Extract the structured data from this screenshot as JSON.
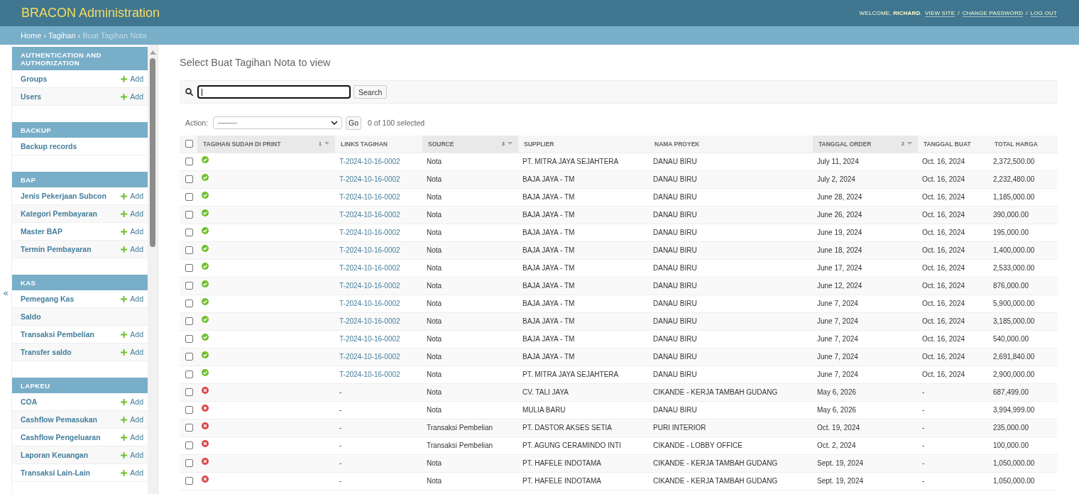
{
  "header": {
    "title": "BRACON Administration",
    "user_tools": [
      {
        "kind": "greeting",
        "text": "WELCOME, **RICHARD**."
      },
      {
        "kind": "link",
        "text": "VIEW SITE"
      },
      {
        "kind": "separator",
        "text": "/"
      },
      {
        "kind": "link",
        "text": "CHANGE PASSWORD"
      },
      {
        "kind": "separator",
        "text": "/"
      },
      {
        "kind": "link",
        "text": "LOG OUT"
      }
    ]
  },
  "breadcrumbs": [
    {
      "kind": "link",
      "text": "Home"
    },
    {
      "kind": "separator",
      "text": "›"
    },
    {
      "kind": "link",
      "text": "Tagihan"
    },
    {
      "kind": "separator",
      "text": "›"
    },
    {
      "kind": "current",
      "text": "Buat Tagihan Nota"
    }
  ],
  "sidebar": {
    "toggle": "«",
    "modules": [
      {
        "caption": "AUTHENTICATION AND AUTHORIZATION",
        "models": [
          {
            "name": "Groups",
            "add": "Add"
          },
          {
            "name": "Users",
            "add": "Add"
          }
        ]
      },
      {
        "caption": "BACKUP",
        "models": [
          {
            "name": "Backup records"
          }
        ]
      },
      {
        "caption": "BAP",
        "models": [
          {
            "name": "Jenis Pekerjaan Subcon",
            "add": "Add"
          },
          {
            "name": "Kategori Pembayaran",
            "add": "Add"
          },
          {
            "name": "Master BAP",
            "add": "Add"
          },
          {
            "name": "Termin Pembayaran",
            "add": "Add"
          }
        ]
      },
      {
        "caption": "KAS",
        "models": [
          {
            "name": "Pemegang Kas",
            "add": "Add"
          },
          {
            "name": "Saldo"
          },
          {
            "name": "Transaksi Pembelian",
            "add": "Add"
          },
          {
            "name": "Transfer saldo",
            "add": "Add"
          }
        ]
      },
      {
        "caption": "LAPKEU",
        "models": [
          {
            "name": "COA",
            "add": "Add"
          },
          {
            "name": "Cashflow Pemasukan",
            "add": "Add"
          },
          {
            "name": "Cashflow Pengeluaran",
            "add": "Add"
          },
          {
            "name": "Laporan Keuangan",
            "add": "Add"
          },
          {
            "name": "Transaksi Lain-Lain",
            "add": "Add"
          }
        ]
      }
    ]
  },
  "main": {
    "title": "Select Buat Tagihan Nota to view",
    "search": {
      "button": "Search"
    },
    "actions": {
      "label": "Action:",
      "value": "---------",
      "button": "Go",
      "counter": "0 of 100 selected"
    }
  },
  "table": {
    "select_all": {
      "checked": false
    },
    "columns": [
      {
        "label": "TAGIHAN SUDAH DI PRINT",
        "sorted": true,
        "priority": "1"
      },
      {
        "label": "LINKS TAGIHAN",
        "sorted": false
      },
      {
        "label": "SOURCE",
        "sorted": true,
        "priority": "3"
      },
      {
        "label": "SUPPLIER",
        "sorted": false
      },
      {
        "label": "NAMA PROYEK",
        "sorted": false
      },
      {
        "label": "TANGGAL ORDER",
        "sorted": true,
        "priority": "2"
      },
      {
        "label": "TANGGAL BUAT",
        "sorted": false
      },
      {
        "label": "TOTAL HARGA",
        "sorted": false
      }
    ],
    "rows": [
      {
        "selected": false,
        "printed": true,
        "links_tagihan": {
          "kind": "link",
          "text": "T-2024-10-16-0002"
        },
        "source": "Nota",
        "supplier": "PT. MITRA JAYA SEJAHTERA",
        "nama_proyek": "DANAU BIRU",
        "tanggal_order": "July 11, 2024",
        "tanggal_buat": "Oct. 16, 2024",
        "total_harga": "2,372,500.00"
      },
      {
        "selected": false,
        "printed": true,
        "links_tagihan": {
          "kind": "link",
          "text": "T-2024-10-16-0002"
        },
        "source": "Nota",
        "supplier": "BAJA JAYA - TM",
        "nama_proyek": "DANAU BIRU",
        "tanggal_order": "July 2, 2024",
        "tanggal_buat": "Oct. 16, 2024",
        "total_harga": "2,232,480.00"
      },
      {
        "selected": false,
        "printed": true,
        "links_tagihan": {
          "kind": "link",
          "text": "T-2024-10-16-0002"
        },
        "source": "Nota",
        "supplier": "BAJA JAYA - TM",
        "nama_proyek": "DANAU BIRU",
        "tanggal_order": "June 28, 2024",
        "tanggal_buat": "Oct. 16, 2024",
        "total_harga": "1,185,000.00"
      },
      {
        "selected": false,
        "printed": true,
        "links_tagihan": {
          "kind": "link",
          "text": "T-2024-10-16-0002"
        },
        "source": "Nota",
        "supplier": "BAJA JAYA - TM",
        "nama_proyek": "DANAU BIRU",
        "tanggal_order": "June 26, 2024",
        "tanggal_buat": "Oct. 16, 2024",
        "total_harga": "390,000.00"
      },
      {
        "selected": false,
        "printed": true,
        "links_tagihan": {
          "kind": "link",
          "text": "T-2024-10-16-0002"
        },
        "source": "Nota",
        "supplier": "BAJA JAYA - TM",
        "nama_proyek": "DANAU BIRU",
        "tanggal_order": "June 19, 2024",
        "tanggal_buat": "Oct. 16, 2024",
        "total_harga": "195,000.00"
      },
      {
        "selected": false,
        "printed": true,
        "links_tagihan": {
          "kind": "link",
          "text": "T-2024-10-16-0002"
        },
        "source": "Nota",
        "supplier": "BAJA JAYA - TM",
        "nama_proyek": "DANAU BIRU",
        "tanggal_order": "June 18, 2024",
        "tanggal_buat": "Oct. 16, 2024",
        "total_harga": "1,400,000.00"
      },
      {
        "selected": false,
        "printed": true,
        "links_tagihan": {
          "kind": "link",
          "text": "T-2024-10-16-0002"
        },
        "source": "Nota",
        "supplier": "BAJA JAYA - TM",
        "nama_proyek": "DANAU BIRU",
        "tanggal_order": "June 17, 2024",
        "tanggal_buat": "Oct. 16, 2024",
        "total_harga": "2,533,000.00"
      },
      {
        "selected": false,
        "printed": true,
        "links_tagihan": {
          "kind": "link",
          "text": "T-2024-10-16-0002"
        },
        "source": "Nota",
        "supplier": "BAJA JAYA - TM",
        "nama_proyek": "DANAU BIRU",
        "tanggal_order": "June 12, 2024",
        "tanggal_buat": "Oct. 16, 2024",
        "total_harga": "876,000.00"
      },
      {
        "selected": false,
        "printed": true,
        "links_tagihan": {
          "kind": "link",
          "text": "T-2024-10-16-0002"
        },
        "source": "Nota",
        "supplier": "BAJA JAYA - TM",
        "nama_proyek": "DANAU BIRU",
        "tanggal_order": "June 7, 2024",
        "tanggal_buat": "Oct. 16, 2024",
        "total_harga": "5,900,000.00"
      },
      {
        "selected": false,
        "printed": true,
        "links_tagihan": {
          "kind": "link",
          "text": "T-2024-10-16-0002"
        },
        "source": "Nota",
        "supplier": "BAJA JAYA - TM",
        "nama_proyek": "DANAU BIRU",
        "tanggal_order": "June 7, 2024",
        "tanggal_buat": "Oct. 16, 2024",
        "total_harga": "3,185,000.00"
      },
      {
        "selected": false,
        "printed": true,
        "links_tagihan": {
          "kind": "link",
          "text": "T-2024-10-16-0002"
        },
        "source": "Nota",
        "supplier": "BAJA JAYA - TM",
        "nama_proyek": "DANAU BIRU",
        "tanggal_order": "June 7, 2024",
        "tanggal_buat": "Oct. 16, 2024",
        "total_harga": "540,000.00"
      },
      {
        "selected": false,
        "printed": true,
        "links_tagihan": {
          "kind": "link",
          "text": "T-2024-10-16-0002"
        },
        "source": "Nota",
        "supplier": "BAJA JAYA - TM",
        "nama_proyek": "DANAU BIRU",
        "tanggal_order": "June 7, 2024",
        "tanggal_buat": "Oct. 16, 2024",
        "total_harga": "2,691,840.00"
      },
      {
        "selected": false,
        "printed": true,
        "links_tagihan": {
          "kind": "link",
          "text": "T-2024-10-16-0002"
        },
        "source": "Nota",
        "supplier": "PT. MITRA JAYA SEJAHTERA",
        "nama_proyek": "DANAU BIRU",
        "tanggal_order": "June 7, 2024",
        "tanggal_buat": "Oct. 16, 2024",
        "total_harga": "2,900,000.00"
      },
      {
        "selected": false,
        "printed": false,
        "links_tagihan": {
          "kind": "text",
          "text": "-"
        },
        "source": "Nota",
        "supplier": "CV. TALI JAYA",
        "nama_proyek": "CIKANDE - KERJA TAMBAH GUDANG",
        "tanggal_order": "May 6, 2026",
        "tanggal_buat": "-",
        "total_harga": "687,499.00"
      },
      {
        "selected": false,
        "printed": false,
        "links_tagihan": {
          "kind": "text",
          "text": "-"
        },
        "source": "Nota",
        "supplier": "MULIA BARU",
        "nama_proyek": "DANAU BIRU",
        "tanggal_order": "May 6, 2026",
        "tanggal_buat": "-",
        "total_harga": "3,994,999.00"
      },
      {
        "selected": false,
        "printed": false,
        "links_tagihan": {
          "kind": "text",
          "text": "-"
        },
        "source": "Transaksi Pembelian",
        "supplier": "PT. DASTOR AKSES SETIA",
        "nama_proyek": "PURI INTERIOR",
        "tanggal_order": "Oct. 19, 2024",
        "tanggal_buat": "-",
        "total_harga": "235,000.00"
      },
      {
        "selected": false,
        "printed": false,
        "links_tagihan": {
          "kind": "text",
          "text": "-"
        },
        "source": "Transaksi Pembelian",
        "supplier": "PT. AGUNG CERAMINDO INTI",
        "nama_proyek": "CIKANDE - LOBBY OFFICE",
        "tanggal_order": "Oct. 2, 2024",
        "tanggal_buat": "-",
        "total_harga": "100,000.00"
      },
      {
        "selected": false,
        "printed": false,
        "links_tagihan": {
          "kind": "text",
          "text": "-"
        },
        "source": "Nota",
        "supplier": "PT. HAFELE INDOTAMA",
        "nama_proyek": "CIKANDE - KERJA TAMBAH GUDANG",
        "tanggal_order": "Sept. 19, 2024",
        "tanggal_buat": "-",
        "total_harga": "1,050,000.00"
      },
      {
        "selected": false,
        "printed": false,
        "links_tagihan": {
          "kind": "text",
          "text": "-"
        },
        "source": "Nota",
        "supplier": "PT. HAFELE INDOTAMA",
        "nama_proyek": "CIKANDE - KERJA TAMBAH GUDANG",
        "tanggal_order": "Sept. 19, 2024",
        "tanggal_buat": "-",
        "total_harga": "1,050,000.00"
      }
    ]
  }
}
